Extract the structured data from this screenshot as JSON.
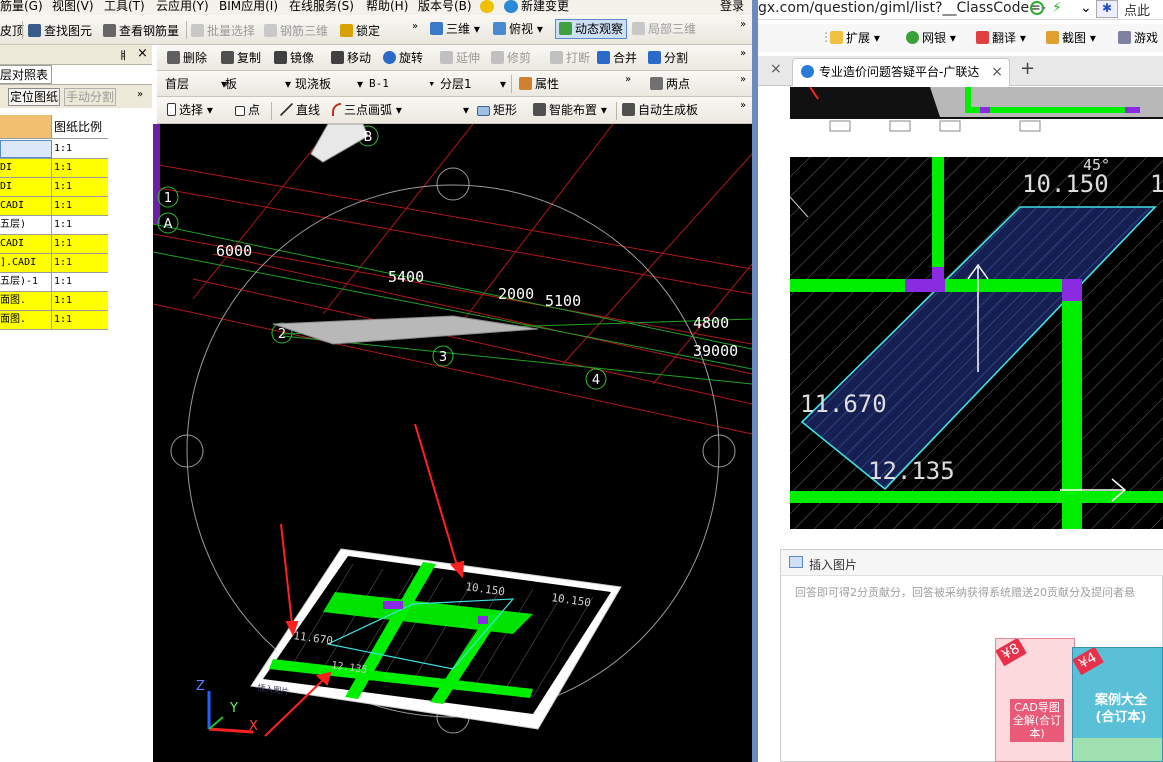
{
  "menu": {
    "items": [
      "筋量(G)",
      "视图(V)",
      "工具(T)",
      "云应用(Y)",
      "BIM应用(I)",
      "在线服务(S)",
      "帮助(H)",
      "版本号(B)",
      "新建变更"
    ],
    "login": "登录"
  },
  "toolbar1": {
    "left": "皮顶",
    "find_element": "查找图元",
    "view_rebar": "查看钢筋量",
    "batch_select": "批量选择",
    "rebar_3d": "钢筋三维",
    "lock": "锁定",
    "view_3d": "三维",
    "top_view": "俯视",
    "dynamic_observe": "动态观察",
    "local_3d": "局部三维"
  },
  "toolbar2": {
    "delete": "删除",
    "copy": "复制",
    "mirror": "镜像",
    "move": "移动",
    "rotate": "旋转",
    "extend": "延伸",
    "trim": "修剪",
    "break": "打断",
    "merge": "合并",
    "split": "分割"
  },
  "toolbar3": {
    "floor": "首层",
    "type": "板",
    "subtype": "现浇板",
    "name": "B-1",
    "layer": "分层1",
    "properties": "属性",
    "two_points": "两点"
  },
  "toolbar4": {
    "select": "选择",
    "point": "点",
    "line": "直线",
    "arc": "三点画弧",
    "rect": "矩形",
    "smart_layout": "智能布置",
    "auto_slab": "自动生成板"
  },
  "left_panel": {
    "tab_title": "层对照表",
    "locate_drawing": "定位图纸",
    "manual_split": "手动分割",
    "col_header": "图纸比例",
    "rows": [
      {
        "name": "",
        "ratio": "1:1",
        "hl": false,
        "sel": true
      },
      {
        "name": "DI",
        "ratio": "1:1",
        "hl": true
      },
      {
        "name": "DI",
        "ratio": "1:1",
        "hl": true
      },
      {
        "name": "CADI",
        "ratio": "1:1",
        "hl": true
      },
      {
        "name": "五层)",
        "ratio": "1:1",
        "hl": false
      },
      {
        "name": "CADI",
        "ratio": "1:1",
        "hl": true
      },
      {
        "name": "].CADI",
        "ratio": "1:1",
        "hl": true
      },
      {
        "name": "五层)-1",
        "ratio": "1:1",
        "hl": false
      },
      {
        "name": "面图.",
        "ratio": "1:1",
        "hl": true
      },
      {
        "name": "面图.",
        "ratio": "1:1",
        "hl": true
      }
    ]
  },
  "viewport": {
    "dims": [
      "6000",
      "5400",
      "2000",
      "5100",
      "4800",
      "39000"
    ],
    "axis_labels": [
      "1",
      "A",
      "B",
      "2",
      "3",
      "4"
    ],
    "inner_labels": [
      "10.150",
      "10.150",
      "11.670",
      "12.135"
    ],
    "axes": [
      "Z",
      "Y",
      "X"
    ],
    "img_caption": "插入图片"
  },
  "browser": {
    "url": "gx.com/question/giml/list?__ClassCode=-",
    "tab_title": "专业造价问题答疑平台-广联达",
    "ext_label": "扩展",
    "bank_label": "网银",
    "translate_label": "翻译",
    "screenshot_label": "截图",
    "games_label": "游戏",
    "click_here": "点此",
    "annotations": [
      "45°",
      "10.150",
      "11.670",
      "12.135",
      "1"
    ],
    "insert_image": "插入图片",
    "answer_placeholder": "回答即可得2分贡献分，回答被采纳获得系统赠送20贡献分及提问者悬",
    "ad1_price": "¥8",
    "ad1_text": "CAD导图全解(合订本)",
    "ad2_price": "¥4",
    "ad2_text": "案例大全(合订本)"
  },
  "colors": {
    "green": "#00ff00",
    "red_arrow": "#ff2020",
    "cyan": "#40e0e0",
    "purple": "#8a2be2"
  }
}
